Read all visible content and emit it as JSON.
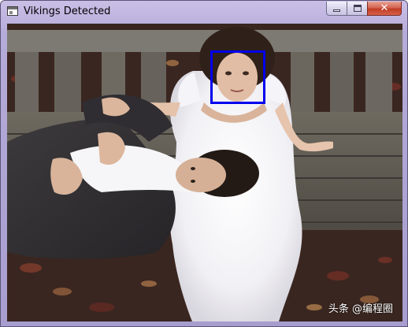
{
  "window": {
    "title": "Vikings Detected",
    "app_icon": "window-app-icon",
    "controls": {
      "minimize": {
        "icon": "minimize-icon"
      },
      "maximize": {
        "icon": "maximize-icon"
      },
      "close": {
        "icon": "close-icon",
        "glyph": "✕"
      }
    }
  },
  "image": {
    "detections": [
      {
        "label": "face",
        "color": "#0000ee"
      }
    ],
    "watermark": "头条 @编程圈"
  },
  "colors": {
    "titlebar": "#b6acd9",
    "detection_box": "#0000ee",
    "close_button": "#c13c25"
  }
}
